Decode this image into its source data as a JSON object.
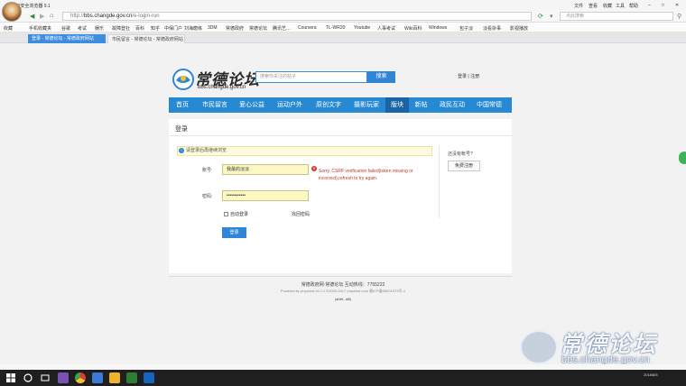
{
  "browser": {
    "app_title": "360安全浏览器 9.1",
    "menu": [
      "文件",
      "查看",
      "收藏",
      "工具",
      "帮助"
    ],
    "url_prefix": "http://",
    "url_domain": "bbs.changde.gov.cn",
    "url_path": "/e-login-run",
    "search_placeholder": "点此搜索",
    "bookmarks": [
      "收藏",
      "手机收藏夹",
      "谷歌",
      "考试",
      "娱乐",
      "故障登社",
      "百科",
      "知乎",
      "中保门户",
      "刘海磨练",
      "3DM",
      "常德政府",
      "常德论坛",
      "腾讯艺…",
      "Coursera",
      "TL-WR20",
      "Youtube",
      "人事考试",
      "Wiki百科",
      "Windows",
      "包子淡",
      "淡看杂事",
      "影视播放"
    ],
    "tabs": [
      {
        "label": "登录 - 常德论坛 - 常德政府网站",
        "active": true
      },
      {
        "label": "市民留言 - 常德论坛 - 常德政府网站",
        "active": false
      }
    ]
  },
  "site": {
    "brand_name": "常德论坛",
    "brand_url": "bbs.changde.gov.cn",
    "search_placeholder": "搜索你关注的帖子",
    "search_button": "搜索",
    "login_link": "登录 | 注册",
    "nav": [
      {
        "label": "首页",
        "active": false
      },
      {
        "label": "市民留言",
        "active": false
      },
      {
        "label": "爱心公益",
        "active": false
      },
      {
        "label": "运动户外",
        "active": false
      },
      {
        "label": "原创文字",
        "active": false
      },
      {
        "label": "摄影玩家",
        "active": false
      },
      {
        "label": "版块",
        "active": true
      },
      {
        "label": "新帖",
        "active": false
      },
      {
        "label": "政民互动",
        "active": false
      },
      {
        "label": "中国常德",
        "active": false
      }
    ]
  },
  "login": {
    "title": "登录",
    "notice": "请登录后再继续浏览",
    "account_label": "账号:",
    "account_value": "我最的淡淡",
    "password_label": "密码:",
    "password_value": "••••••••••••",
    "error_message": "Sorry, CSRF verification failed(token missing or incorrect),refresh to try again.",
    "remember_label": "自动登录",
    "forgot_label": "找回密码",
    "submit_label": "登录",
    "no_account": "还没有帐号?",
    "register_button": "免费注册"
  },
  "footer": {
    "line1": "常德政府网·常德论坛    互动热线：7755222",
    "line2": "Powered by phpwind v9.0.1 ©2003-2017 phpwind.com  湘ICP备05001573号-1",
    "line3": "(shift...d8)"
  },
  "watermark": {
    "name": "常德论坛",
    "url": "bbs.changde.gov.cn"
  },
  "taskbar": {
    "time": "2018/8/5"
  },
  "colors": {
    "brand_blue": "#2789d2",
    "nav_active": "#1a64a6",
    "error_red": "#d63a2f",
    "input_yellow": "#fbf8c4"
  }
}
